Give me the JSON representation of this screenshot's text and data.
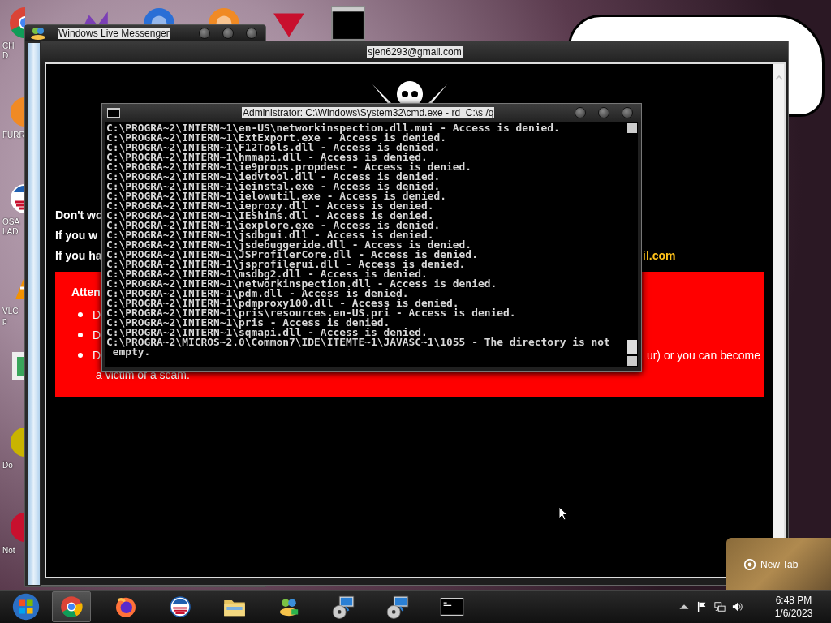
{
  "desktop": {
    "icons": [
      {
        "kind": "chrome",
        "labels": [
          "CH",
          "D"
        ]
      },
      {
        "kind": "orange",
        "labels": [
          "FURR"
        ]
      },
      {
        "kind": "obama",
        "labels": [
          "OSA",
          "LAD"
        ]
      },
      {
        "kind": "cone",
        "labels": [
          "VLC",
          "p"
        ]
      },
      {
        "kind": "green"
      },
      {
        "kind": "yellow",
        "labels": [
          "Do"
        ]
      },
      {
        "kind": "red",
        "labels": [
          "Not"
        ]
      }
    ],
    "top_icons": [
      {
        "kind": "purple"
      },
      {
        "kind": "blue"
      },
      {
        "kind": "orange"
      },
      {
        "kind": "red"
      },
      {
        "kind": "console"
      }
    ]
  },
  "messenger": {
    "title": "Windows Live Messenger",
    "chat_title": "sjen6293@gmail.com",
    "lines": [
      {
        "text": "Don't wo"
      },
      {
        "text": "If you w"
      },
      {
        "text": "If you ha",
        "tail": "il.com"
      }
    ],
    "attention": {
      "heading": "Atten",
      "bullets": [
        {
          "text": "D"
        },
        {
          "text": "D"
        },
        {
          "text": "D",
          "tail": "ur) or you can become",
          "continuation": "a victim of a scam."
        }
      ]
    }
  },
  "console": {
    "title": "Administrator: C:\\Windows\\System32\\cmd.exe - rd  C:\\s /q",
    "lines": [
      "C:\\PROGRA~2\\INTERN~1\\en-US\\networkinspection.dll.mui - Access is denied.",
      "C:\\PROGRA~2\\INTERN~1\\ExtExport.exe - Access is denied.",
      "C:\\PROGRA~2\\INTERN~1\\F12Tools.dll - Access is denied.",
      "C:\\PROGRA~2\\INTERN~1\\hmmapi.dll - Access is denied.",
      "C:\\PROGRA~2\\INTERN~1\\ie9props.propdesc - Access is denied.",
      "C:\\PROGRA~2\\INTERN~1\\iedvtool.dll - Access is denied.",
      "C:\\PROGRA~2\\INTERN~1\\ieinstal.exe - Access is denied.",
      "C:\\PROGRA~2\\INTERN~1\\ielowutil.exe - Access is denied.",
      "C:\\PROGRA~2\\INTERN~1\\ieproxy.dll - Access is denied.",
      "C:\\PROGRA~2\\INTERN~1\\IEShims.dll - Access is denied.",
      "C:\\PROGRA~2\\INTERN~1\\iexplore.exe - Access is denied.",
      "C:\\PROGRA~2\\INTERN~1\\jsdbgui.dll - Access is denied.",
      "C:\\PROGRA~2\\INTERN~1\\jsdebuggeride.dll - Access is denied.",
      "C:\\PROGRA~2\\INTERN~1\\JSProfilerCore.dll - Access is denied.",
      "C:\\PROGRA~2\\INTERN~1\\jsprofilerui.dll - Access is denied.",
      "C:\\PROGRA~2\\INTERN~1\\msdbg2.dll - Access is denied.",
      "C:\\PROGRA~2\\INTERN~1\\networkinspection.dll - Access is denied.",
      "C:\\PROGRA~2\\INTERN~1\\pdm.dll - Access is denied.",
      "C:\\PROGRA~2\\INTERN~1\\pdmproxy100.dll - Access is denied.",
      "C:\\PROGRA~2\\INTERN~1\\pris\\resources.en-US.pri - Access is denied.",
      "C:\\PROGRA~2\\INTERN~1\\pris - Access is denied.",
      "C:\\PROGRA~2\\INTERN~1\\sqmapi.dll - Access is denied.",
      "C:\\PROGRA~2\\MICROS~2.0\\Common7\\IDE\\ITEMTE~1\\JAVASC~1\\1055 - The directory is not",
      " empty."
    ]
  },
  "tab_preview": {
    "title": "New Tab"
  },
  "taskbar": {
    "items": [
      {
        "kind": "chrome",
        "selected": true
      },
      {
        "kind": "firefox",
        "selected": false
      },
      {
        "kind": "obama",
        "selected": false
      },
      {
        "kind": "folder",
        "selected": false
      },
      {
        "kind": "messenger",
        "selected": false
      },
      {
        "kind": "installer",
        "selected": false
      },
      {
        "kind": "installer",
        "selected": false
      },
      {
        "kind": "console",
        "selected": false
      }
    ],
    "clock": {
      "time": "6:48 PM",
      "date": "1/6/2023"
    }
  }
}
